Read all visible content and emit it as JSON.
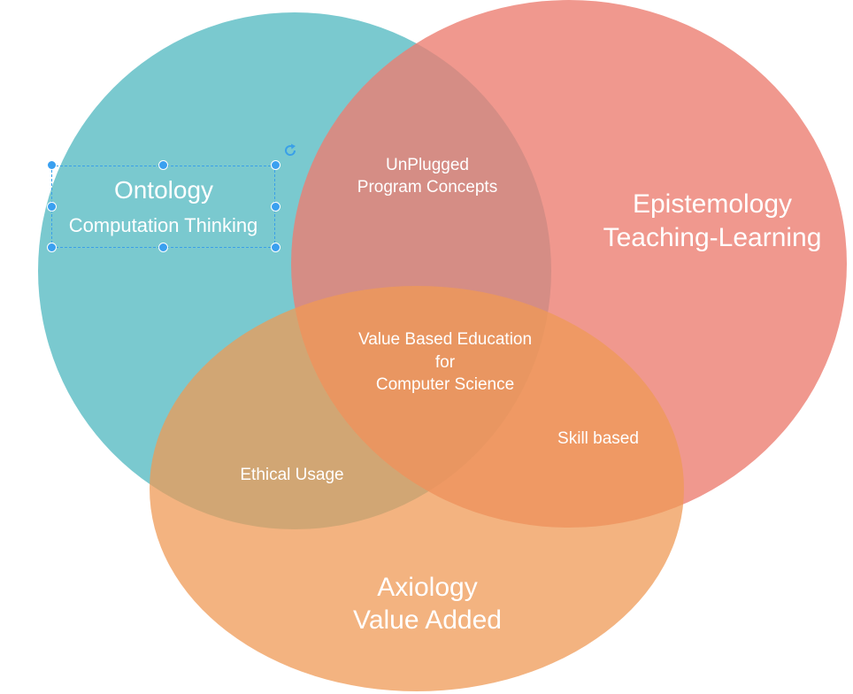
{
  "colors": {
    "ontology_circle": "#76c7cd",
    "epistemology_circle": "#ef8f85",
    "axiology_circle": "#f3b07a",
    "selection": "#3aa0e8",
    "text": "#ffffff"
  },
  "circles": {
    "ontology": {
      "title": "Ontology",
      "subtitle": "Computation Thinking"
    },
    "epistemology": {
      "title": "Epistemology",
      "subtitle": "Teaching-Learning"
    },
    "axiology": {
      "title": "Axiology",
      "subtitle": "Value Added"
    }
  },
  "intersections": {
    "ontology_epistemology": {
      "line1": "UnPlugged",
      "line2": "Program Concepts"
    },
    "ontology_axiology": {
      "label": "Ethical Usage"
    },
    "epistemology_axiology": {
      "label": "Skill based"
    },
    "center": {
      "line1": "Value Based Education",
      "line2": "for",
      "line3": "Computer Science"
    }
  },
  "selection_icons": {
    "rotate": "rotate-icon"
  }
}
